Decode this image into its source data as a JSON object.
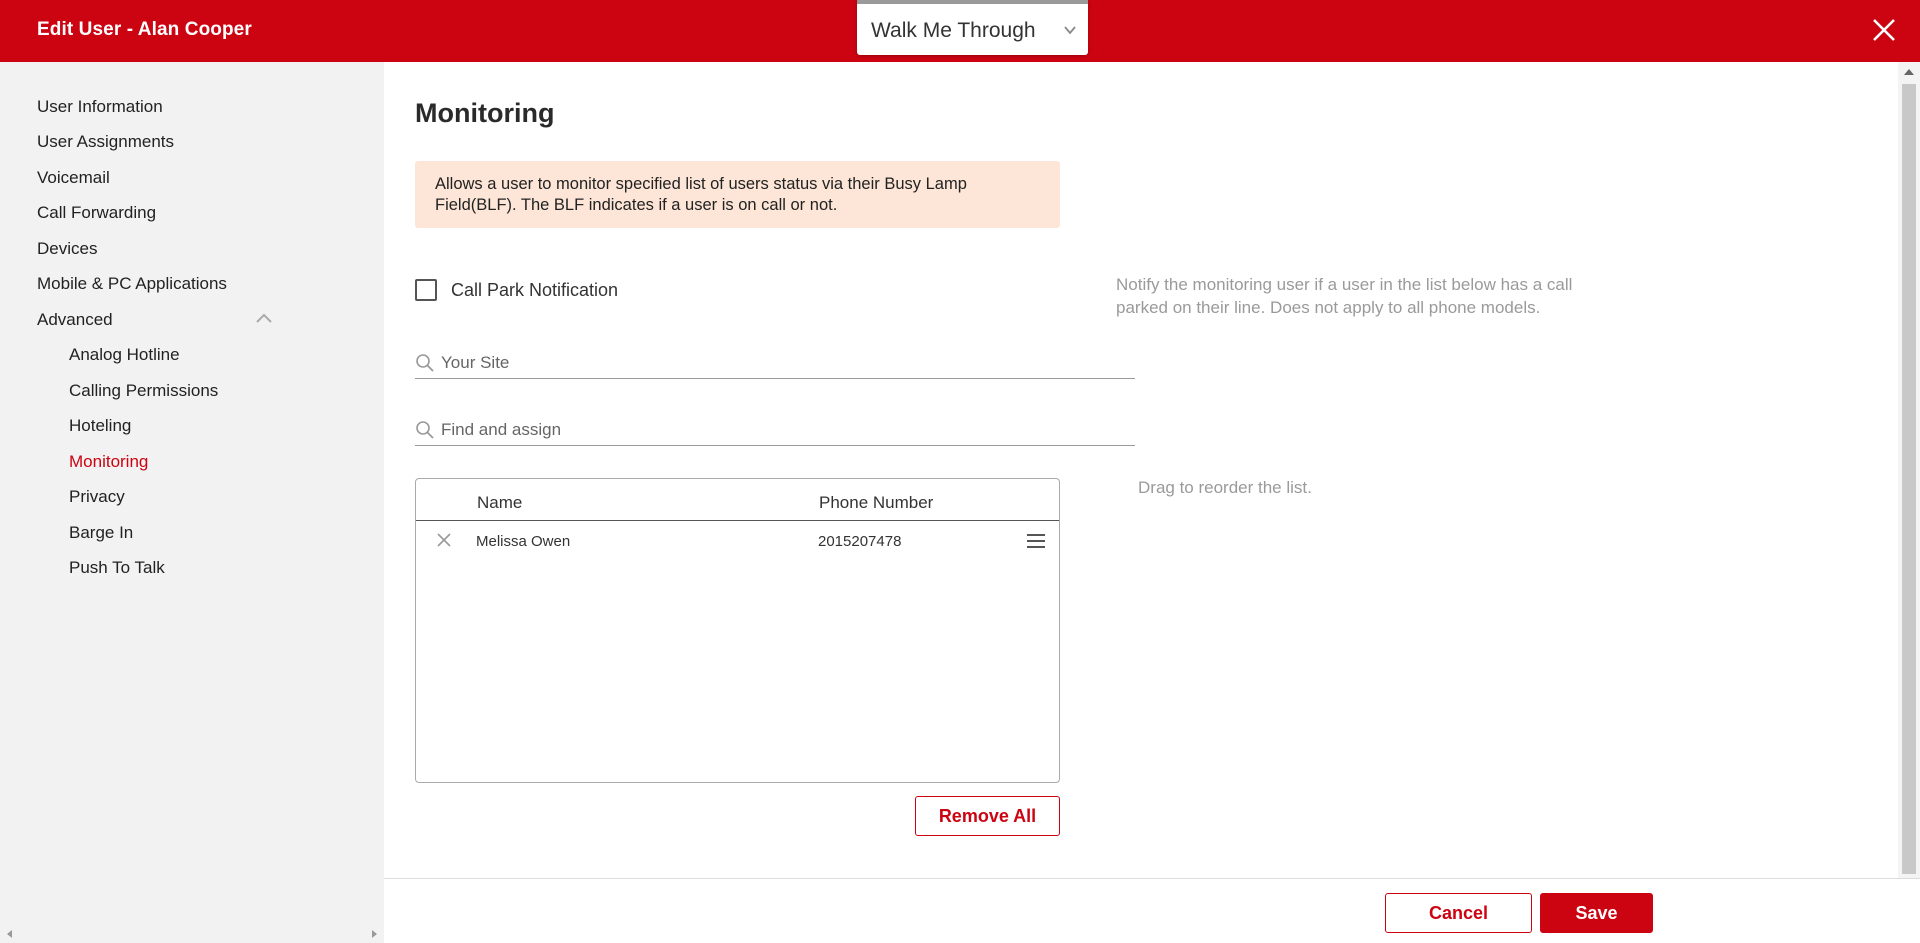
{
  "header": {
    "title": "Edit User - Alan Cooper",
    "walkme_label": "Walk Me Through",
    "icons": {
      "walkme": "chevron-down-icon",
      "close": "close-icon"
    }
  },
  "sidebar": {
    "items": [
      {
        "label": "User Information"
      },
      {
        "label": "User Assignments"
      },
      {
        "label": "Voicemail"
      },
      {
        "label": "Call Forwarding"
      },
      {
        "label": "Devices"
      },
      {
        "label": "Mobile & PC Applications"
      },
      {
        "label": "Advanced",
        "expanded": true
      }
    ],
    "advanced_items": [
      {
        "label": "Analog Hotline"
      },
      {
        "label": "Calling Permissions"
      },
      {
        "label": "Hoteling"
      },
      {
        "label": "Monitoring",
        "active": true
      },
      {
        "label": "Privacy"
      },
      {
        "label": "Barge In"
      },
      {
        "label": "Push To Talk"
      }
    ]
  },
  "main": {
    "title": "Monitoring",
    "info": "Allows a user to monitor specified list of users status via their Busy Lamp Field(BLF). The BLF indicates if a user is on call or not.",
    "call_park": {
      "label": "Call Park Notification",
      "checked": false,
      "help": "Notify the monitoring user if a user in the list below has a call parked on their line. Does not apply to all phone models."
    },
    "site_search": {
      "placeholder": "Your Site",
      "value": ""
    },
    "assign_search": {
      "placeholder": "Find and assign",
      "value": ""
    },
    "table": {
      "columns": [
        "Name",
        "Phone Number"
      ],
      "rows": [
        {
          "name": "Melissa Owen",
          "phone": "2015207478"
        }
      ]
    },
    "drag_help": "Drag to reorder the list.",
    "remove_all_label": "Remove All"
  },
  "footer": {
    "cancel_label": "Cancel",
    "save_label": "Save"
  },
  "colors": {
    "brand": "#cc0311",
    "sidebar_bg": "#f2f2f2",
    "info_bg": "#fde6d7",
    "muted_text": "#9a9a9a"
  }
}
